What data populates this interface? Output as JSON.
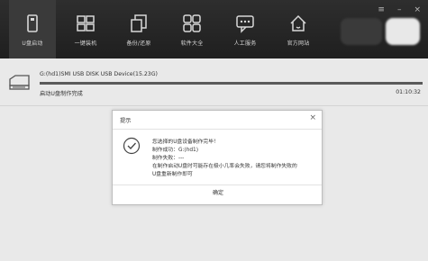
{
  "nav": {
    "items": [
      {
        "label": "U盘启动",
        "icon": "usb-drive-icon",
        "active": true
      },
      {
        "label": "一键装机",
        "icon": "windows-icon",
        "active": false
      },
      {
        "label": "备份/还原",
        "icon": "backup-restore-icon",
        "active": false
      },
      {
        "label": "软件大全",
        "icon": "apps-grid-icon",
        "active": false
      },
      {
        "label": "人工服务",
        "icon": "chat-service-icon",
        "active": false
      },
      {
        "label": "官方网站",
        "icon": "home-icon",
        "active": false
      }
    ]
  },
  "window": {
    "menu_glyph": "≡",
    "minimize_glyph": "–",
    "close_glyph": "×"
  },
  "device": {
    "name": "G:(hd1)SMI USB DISK USB Device(15.23G)",
    "status": "启动U盘制作完成",
    "elapsed": "01:10:32",
    "progress": 1.0,
    "icon": "usb-drive-icon"
  },
  "dialog": {
    "title": "提示",
    "close_glyph": "×",
    "icon": "check-circle-icon",
    "lines": [
      "您选择的U盘设备制作完毕！",
      "制作成功：G:(hd1)",
      "制作失败：---",
      "在制作启动U盘时可能存在极小几率会失败，请您将制作失败的",
      "U盘重新制作即可"
    ],
    "ok_label": "确定"
  },
  "colors": {
    "topbar": "#1f1f1f",
    "nav_active": "#3a3a3a",
    "body": "#e9e9e9",
    "progress": "#5a5a5a"
  }
}
